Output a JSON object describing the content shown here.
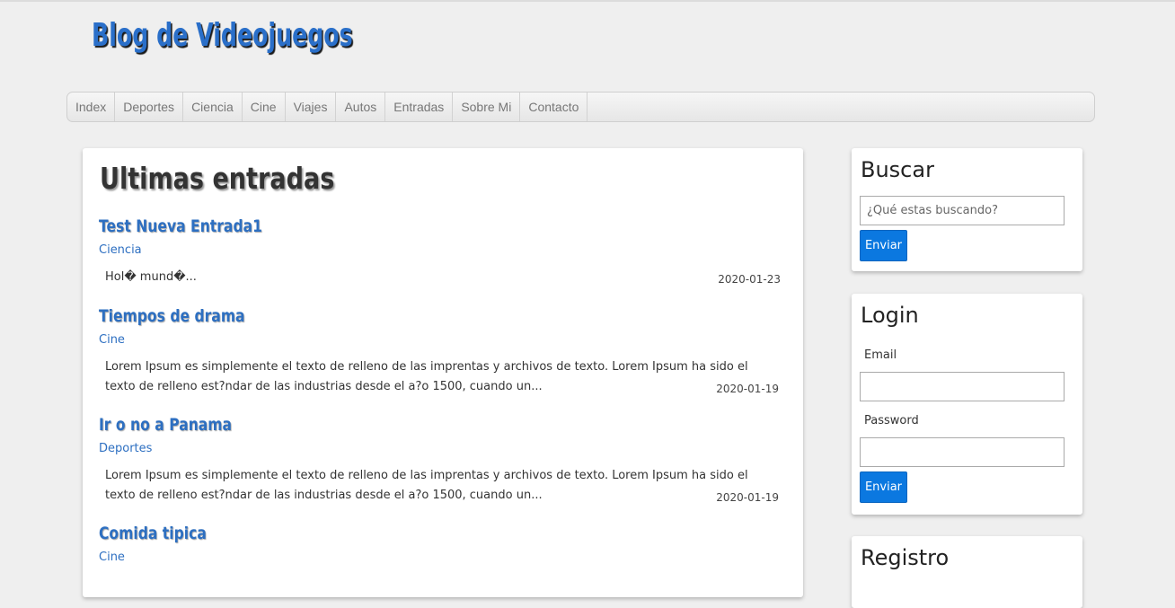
{
  "site": {
    "title": "Blog de Videojuegos"
  },
  "nav": {
    "items": [
      {
        "label": "Index"
      },
      {
        "label": "Deportes"
      },
      {
        "label": "Ciencia"
      },
      {
        "label": "Cine"
      },
      {
        "label": "Viajes"
      },
      {
        "label": "Autos"
      },
      {
        "label": "Entradas"
      },
      {
        "label": "Sobre Mi"
      },
      {
        "label": "Contacto"
      }
    ]
  },
  "main": {
    "title": "Ultimas entradas",
    "entries": [
      {
        "title": "Test Nueva Entrada1",
        "category": "Ciencia",
        "excerpt": "Hol� mund�...",
        "date": "2020-01-23"
      },
      {
        "title": "Tiempos de drama",
        "category": "Cine",
        "excerpt": "Lorem Ipsum es simplemente el texto de relleno de las imprentas y archivos de texto. Lorem Ipsum ha sido el texto de relleno est?ndar de las industrias desde el a?o 1500, cuando un...",
        "date": "2020-01-19"
      },
      {
        "title": "Ir o no a Panama",
        "category": "Deportes",
        "excerpt": "Lorem Ipsum es simplemente el texto de relleno de las imprentas y archivos de texto. Lorem Ipsum ha sido el texto de relleno est?ndar de las industrias desde el a?o 1500, cuando un...",
        "date": "2020-01-19"
      },
      {
        "title": "Comida tipica",
        "category": "Cine",
        "excerpt": "",
        "date": ""
      }
    ]
  },
  "sidebar": {
    "search": {
      "title": "Buscar",
      "placeholder": "¿Qué estas buscando?",
      "button": "Enviar"
    },
    "login": {
      "title": "Login",
      "email_label": "Email",
      "password_label": "Password",
      "button": "Enviar"
    },
    "register": {
      "title": "Registro"
    }
  },
  "colors": {
    "accent": "#2d6fc1",
    "button": "#0b78e0",
    "background": "#efefef"
  }
}
